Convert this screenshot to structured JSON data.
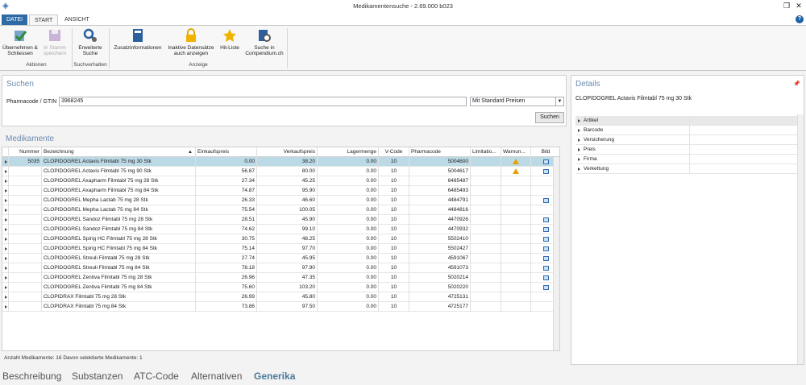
{
  "window": {
    "title": "Medikamentensuche - 2.69.000 b023"
  },
  "ribbon_tabs": [
    "DATEI",
    "START",
    "ANSICHT"
  ],
  "ribbon": {
    "buttons": [
      {
        "label1": "Übernehmen &",
        "label2": "Schliessen",
        "icon": "accept-close-icon"
      },
      {
        "label1": "In Stamm",
        "label2": "speichern",
        "icon": "save-icon"
      },
      {
        "label1": "Erweiterte",
        "label2": "Suche",
        "icon": "advanced-search-icon"
      },
      {
        "label1": "Zusatzinformationen",
        "label2": "",
        "icon": "book-icon"
      },
      {
        "label1": "Inaktive Datensätze",
        "label2": "auch anzeigen",
        "icon": "lock-icon"
      },
      {
        "label1": "Hit-Liste",
        "label2": "",
        "icon": "star-icon"
      },
      {
        "label1": "Suche in",
        "label2": "Compendium.ch",
        "icon": "compendium-icon"
      }
    ],
    "groups": [
      "Aktionen",
      "Suchverhalten",
      "Anzeige"
    ]
  },
  "search": {
    "title": "Suchen",
    "label": "Pharmacode / GTIN",
    "value": "3968245",
    "price_option": "Mit Standard Preisen",
    "button": "Suchen"
  },
  "medikamente": {
    "title": "Medikamente",
    "columns": [
      "Nummer",
      "Bezeichnung",
      "Einkaufspreis",
      "Verkaufspreis",
      "Lagermenge",
      "V-Code",
      "Pharmacode",
      "Limitatio...",
      "Warnun...",
      "Bild"
    ],
    "rows": [
      {
        "nummer": "5035",
        "bez": "CLOPIDOGREL Actavis Filmtabl 75 mg 30 Stk",
        "ek": "0.00",
        "vk": "38.20",
        "lager": "0.00",
        "vcode": "10",
        "pharma": "5004600",
        "warn": true,
        "bild": true
      },
      {
        "nummer": "",
        "bez": "CLOPIDOGREL Actavis Filmtabl 75 mg 90 Stk",
        "ek": "56.87",
        "vk": "80.00",
        "lager": "0.00",
        "vcode": "10",
        "pharma": "5004617",
        "warn": true,
        "bild": true
      },
      {
        "nummer": "",
        "bez": "CLOPIDOGREL Axapharm Filmtabl 75 mg 28 Stk",
        "ek": "27.34",
        "vk": "45.25",
        "lager": "0.00",
        "vcode": "10",
        "pharma": "6485487",
        "warn": false,
        "bild": false
      },
      {
        "nummer": "",
        "bez": "CLOPIDOGREL Axapharm Filmtabl 75 mg 84 Stk",
        "ek": "74.87",
        "vk": "95.90",
        "lager": "0.00",
        "vcode": "10",
        "pharma": "6485493",
        "warn": false,
        "bild": false
      },
      {
        "nummer": "",
        "bez": "CLOPIDOGREL Mepha Lactab 75 mg 28 Stk",
        "ek": "26.33",
        "vk": "46.60",
        "lager": "0.00",
        "vcode": "10",
        "pharma": "4484791",
        "warn": false,
        "bild": true
      },
      {
        "nummer": "",
        "bez": "CLOPIDOGREL Mepha Lactab 75 mg 84 Stk",
        "ek": "75.54",
        "vk": "100.05",
        "lager": "0.00",
        "vcode": "10",
        "pharma": "4484816",
        "warn": false,
        "bild": false
      },
      {
        "nummer": "",
        "bez": "CLOPIDOGREL Sandoz Filmtabl 75 mg 28 Stk",
        "ek": "28.51",
        "vk": "45.90",
        "lager": "0.00",
        "vcode": "10",
        "pharma": "4470926",
        "warn": false,
        "bild": true
      },
      {
        "nummer": "",
        "bez": "CLOPIDOGREL Sandoz Filmtabl 75 mg 84 Stk",
        "ek": "74.62",
        "vk": "99.10",
        "lager": "0.00",
        "vcode": "10",
        "pharma": "4470932",
        "warn": false,
        "bild": true
      },
      {
        "nummer": "",
        "bez": "CLOPIDOGREL Spirig HC Filmtabl 75 mg 28 Stk",
        "ek": "30.75",
        "vk": "48.25",
        "lager": "0.00",
        "vcode": "10",
        "pharma": "5502410",
        "warn": false,
        "bild": true
      },
      {
        "nummer": "",
        "bez": "CLOPIDOGREL Spirig HC Filmtabl 75 mg 84 Stk",
        "ek": "75.14",
        "vk": "97.70",
        "lager": "0.00",
        "vcode": "10",
        "pharma": "5502427",
        "warn": false,
        "bild": true
      },
      {
        "nummer": "",
        "bez": "CLOPIDOGREL Streuli Filmtabl 75 mg 28 Stk",
        "ek": "27.74",
        "vk": "45.95",
        "lager": "0.00",
        "vcode": "10",
        "pharma": "4591067",
        "warn": false,
        "bild": true
      },
      {
        "nummer": "",
        "bez": "CLOPIDOGREL Streuli Filmtabl 75 mg 84 Stk",
        "ek": "78.18",
        "vk": "97.90",
        "lager": "0.00",
        "vcode": "10",
        "pharma": "4591073",
        "warn": false,
        "bild": true
      },
      {
        "nummer": "",
        "bez": "CLOPIDOGREL Zentiva Filmtabl 75 mg 28 Stk",
        "ek": "26.96",
        "vk": "47.35",
        "lager": "0.00",
        "vcode": "10",
        "pharma": "5020214",
        "warn": false,
        "bild": true
      },
      {
        "nummer": "",
        "bez": "CLOPIDOGREL Zentiva Filmtabl 75 mg 84 Stk",
        "ek": "75.60",
        "vk": "103.20",
        "lager": "0.00",
        "vcode": "10",
        "pharma": "5020220",
        "warn": false,
        "bild": true
      },
      {
        "nummer": "",
        "bez": "CLOPIDRAX Filmtabl 75 mg 28 Stk",
        "ek": "26.99",
        "vk": "45.80",
        "lager": "0.00",
        "vcode": "10",
        "pharma": "4725131",
        "warn": false,
        "bild": false
      },
      {
        "nummer": "",
        "bez": "CLOPIDRAX Filmtabl 75 mg 84 Stk",
        "ek": "73.86",
        "vk": "97.50",
        "lager": "0.00",
        "vcode": "10",
        "pharma": "4725177",
        "warn": false,
        "bild": false
      }
    ],
    "status": "Anzahl Medikamente: 16  Davon selektierte Medikamente: 1"
  },
  "details": {
    "title": "Details",
    "name": "CLOPIDOGREL Actavis Filmtabl 75 mg 30 Stk",
    "props": [
      "Artikel",
      "Barcode",
      "Versicherung",
      "Preis",
      "Firma",
      "Verkettung"
    ]
  },
  "bottom_tabs": [
    "Beschreibung",
    "Substanzen",
    "ATC-Code",
    "Alternativen",
    "Generika"
  ]
}
